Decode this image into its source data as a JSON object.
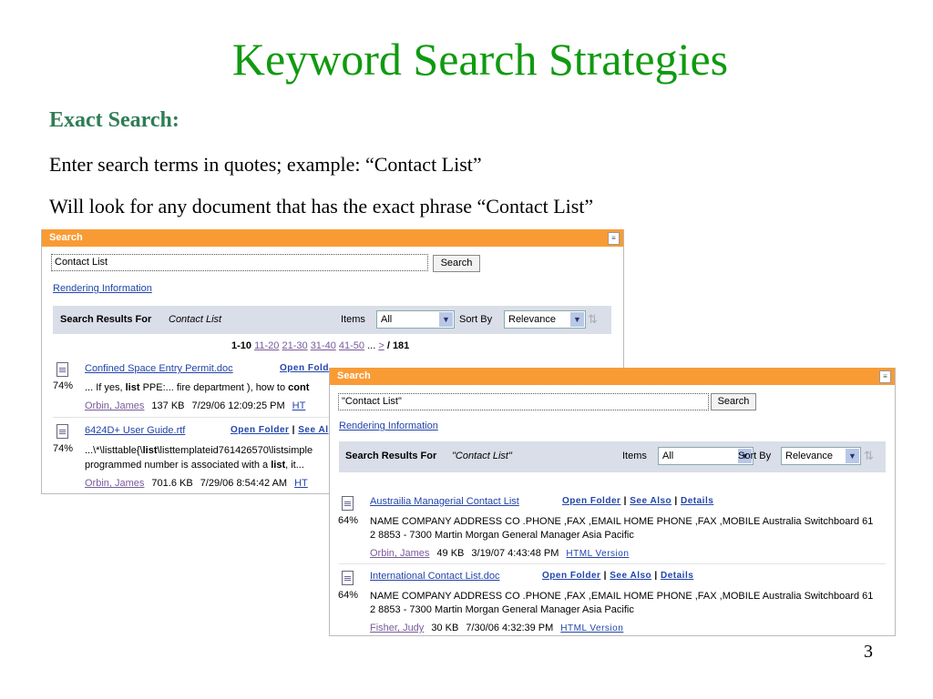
{
  "slide": {
    "title": "Keyword Search Strategies",
    "subtitle": "Exact Search:",
    "line1": "Enter search terms in quotes; example:  “Contact List”",
    "line2": "Will look for any document that has the exact phrase “Contact List”",
    "page_number": "3"
  },
  "colors": {
    "title": "#109a10",
    "header": "#f99b35",
    "link": "#2244aa"
  },
  "panel1": {
    "header": "Search",
    "query": "Contact List",
    "search_label": "Search",
    "rendering": "Rendering Information",
    "results_for": "Search Results For",
    "results_term": "Contact List",
    "items_label": "Items",
    "items_value": "All",
    "sort_label": "Sort By",
    "sort_value": "Relevance",
    "pagination": {
      "current": "1-10",
      "pages": [
        "11-20",
        "21-30",
        "31-40",
        "41-50"
      ],
      "ellipsis": "...",
      "next": ">",
      "total": "/ 181"
    },
    "results": [
      {
        "title": "Confined Space Entry Permit.doc",
        "links": "Open Fold",
        "score": "74%",
        "snippet": [
          {
            "t": "... If yes, "
          },
          {
            "t": "list",
            "b": true
          },
          {
            "t": " PPE:... fire department ), how to "
          },
          {
            "t": "cont",
            "b": true
          }
        ],
        "author": "Orbin, James",
        "size": "137 KB",
        "date": "7/29/06 12:09:25 PM",
        "html": "HT"
      },
      {
        "title": "6424D+ User Guide.rtf",
        "open": "Open Folder",
        "see": "See Al",
        "score": "74%",
        "snippet1": [
          {
            "t": "...\\*\\listtable{\\"
          },
          {
            "t": "list",
            "b": true
          },
          {
            "t": "\\listtemplateid761426570\\listsimple"
          }
        ],
        "snippet2": [
          {
            "t": "programmed number is associated with a "
          },
          {
            "t": "list",
            "b": true
          },
          {
            "t": ", it..."
          }
        ],
        "author": "Orbin, James",
        "size": "701.6 KB",
        "date": "7/29/06 8:54:42 AM",
        "html": "HT"
      }
    ]
  },
  "panel2": {
    "header": "Search",
    "query": "\"Contact List\"",
    "search_label": "Search",
    "rendering": "Rendering Information",
    "results_for": "Search Results For",
    "results_term": "\"Contact List\"",
    "items_label": "Items",
    "items_value": "All",
    "sort_label": "Sort By",
    "sort_value": "Relevance",
    "results": [
      {
        "title": "Austrailia Managerial Contact List",
        "open": "Open Folder",
        "see": "See Also",
        "details": "Details",
        "score": "64%",
        "snippet1": "NAME COMPANY ADDRESS CO .PHONE ,FAX ,EMAIL HOME PHONE ,FAX ,MOBILE Australia Switchboard 61",
        "snippet2": "2 8853 - 7300 Martin Morgan General Manager Asia Pacific",
        "author": "Orbin, James",
        "size": "49 KB",
        "date": "3/19/07 4:43:48 PM",
        "html": "HTML Version"
      },
      {
        "title": "International Contact List.doc",
        "open": "Open Folder",
        "see": "See Also",
        "details": "Details",
        "score": "64%",
        "snippet1": "NAME COMPANY ADDRESS CO .PHONE ,FAX ,EMAIL HOME PHONE ,FAX ,MOBILE Australia Switchboard 61",
        "snippet2": "2 8853 - 7300 Martin Morgan General Manager Asia Pacific",
        "author": "Fisher, Judy",
        "size": "30 KB",
        "date": "7/30/06 4:32:39 PM",
        "html": "HTML Version"
      }
    ]
  }
}
